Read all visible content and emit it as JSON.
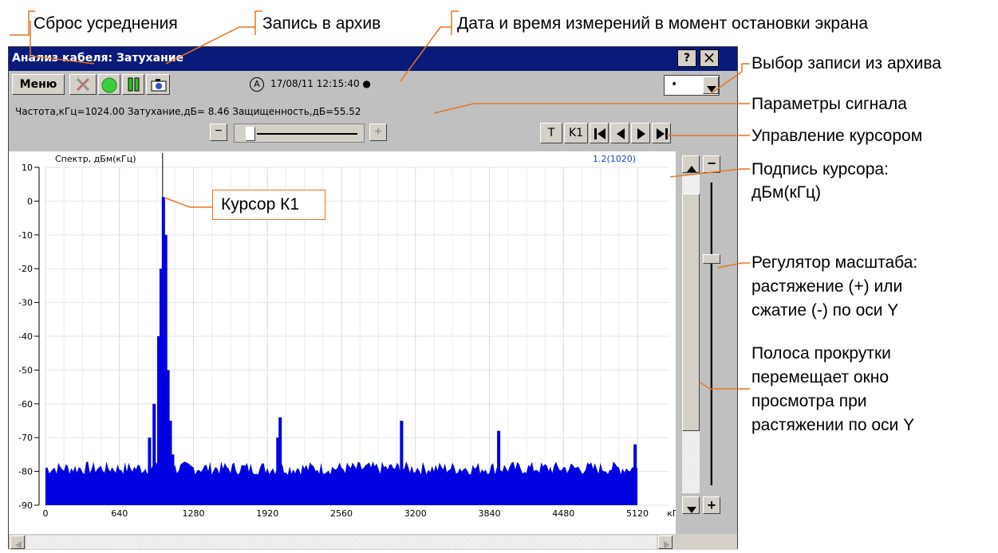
{
  "callouts": {
    "reset": "Сброс усреднения",
    "archive_save": "Запись в архив",
    "datetime": "Дата и время измерений в момент остановки экрана",
    "archive_select": "Выбор записи из архива",
    "signal_params": "Параметры сигнала",
    "cursor_control": "Управление курсором",
    "cursor_label_line1": "Подпись курсора:",
    "cursor_label_line2": "дБм(кГц)",
    "cursor_k1": "Курсор К1",
    "zoom_line1": "Регулятор масштаба:",
    "zoom_line2": "растяжение (+) или",
    "zoom_line3": "сжатие (-) по оси Y",
    "scroll_line1": "Полоса прокрутки",
    "scroll_line2": "перемещает окно",
    "scroll_line3": "просмотра при",
    "scroll_line4": "растяжении по оси Y"
  },
  "window": {
    "title": "Анализ кабеля: Затухание",
    "help": "?",
    "close": "×"
  },
  "toolbar": {
    "menu": "Меню",
    "mode_marker": "A",
    "datetime": "17/08/11 12:15:40 ●",
    "archive_value": "•"
  },
  "params": {
    "text": "Частота,кГц=1024.00  Затухание,дБ= 8.46  Защищенность,дБ=55.52"
  },
  "cursor_buttons": {
    "t": "T",
    "k1": "K1"
  },
  "zoom": {
    "minus": "−",
    "plus": "+"
  },
  "chart_data": {
    "type": "bar",
    "title": "Спектр, дБм(кГц)",
    "cursor_label": "1.2(1020)",
    "xunit": "кГц",
    "xlim": [
      0,
      5120
    ],
    "ylim": [
      -90,
      10
    ],
    "xticks": [
      0,
      640,
      1280,
      1920,
      2560,
      3200,
      3840,
      4480,
      5120
    ],
    "yticks": [
      10,
      0,
      -10,
      -20,
      -30,
      -40,
      -50,
      -60,
      -70,
      -80,
      -90
    ],
    "cursor_x": 1020,
    "noise_floor": -79,
    "peaks": [
      {
        "x": 900,
        "y": -70
      },
      {
        "x": 940,
        "y": -60
      },
      {
        "x": 980,
        "y": -40
      },
      {
        "x": 1000,
        "y": -20
      },
      {
        "x": 1020,
        "y": 1.2
      },
      {
        "x": 1040,
        "y": -10
      },
      {
        "x": 1060,
        "y": -50
      },
      {
        "x": 1080,
        "y": -65
      },
      {
        "x": 1100,
        "y": -75
      },
      {
        "x": 2030,
        "y": -64
      },
      {
        "x": 2010,
        "y": -70
      },
      {
        "x": 3080,
        "y": -65
      },
      {
        "x": 3920,
        "y": -68
      },
      {
        "x": 5100,
        "y": -72
      }
    ]
  }
}
